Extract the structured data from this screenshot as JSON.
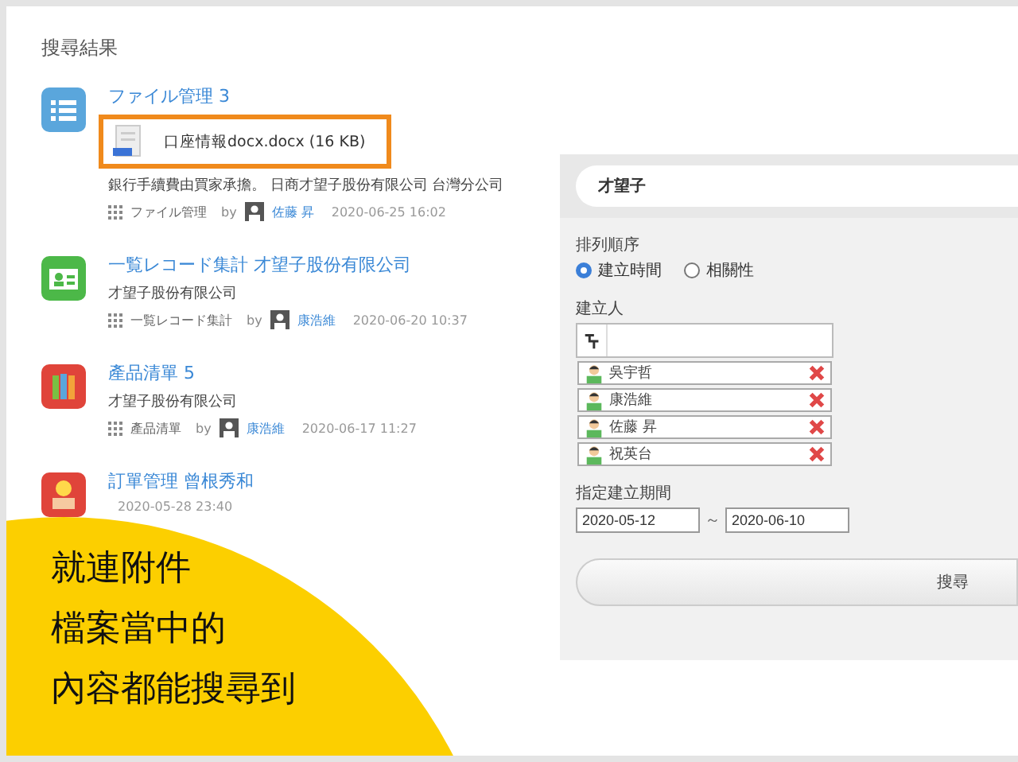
{
  "heading": "搜尋結果",
  "results": [
    {
      "kind": "list",
      "title": "ファイル管理 3",
      "attachment": {
        "name": "口座情報docx.docx (16 KB)"
      },
      "description": "銀行手續費由買家承擔。 日商才望子股份有限公司 台灣分公司",
      "category": "ファイル管理",
      "by": "by",
      "author": "佐藤 昇",
      "date": "2020-06-25 16:02"
    },
    {
      "kind": "card",
      "title": "一覧レコード集計 才望子股份有限公司",
      "description": "才望子股份有限公司",
      "category": "一覧レコード集計",
      "by": "by",
      "author": "康浩維",
      "date": "2020-06-20 10:37"
    },
    {
      "kind": "binder",
      "title": "產品清單 5",
      "description": "才望子股份有限公司",
      "category": "產品清單",
      "by": "by",
      "author": "康浩維",
      "date": "2020-06-17 11:27"
    },
    {
      "kind": "person",
      "title": "訂單管理 曾根秀和",
      "date": "2020-05-28 23:40"
    }
  ],
  "search": {
    "value": "才望子"
  },
  "sort": {
    "label": "排列順序",
    "options": [
      {
        "label": "建立時間",
        "selected": true
      },
      {
        "label": "相關性",
        "selected": false
      }
    ]
  },
  "creator": {
    "label": "建立人",
    "users": [
      "吳宇哲",
      "康浩維",
      "佐藤 昇",
      "祝英台"
    ]
  },
  "period": {
    "label": "指定建立期間",
    "from": "2020-05-12",
    "separator": "～",
    "to": "2020-06-10"
  },
  "search_button": "搜尋",
  "callout": [
    "就連附件",
    "檔案當中的",
    "內容都能搜尋到"
  ]
}
